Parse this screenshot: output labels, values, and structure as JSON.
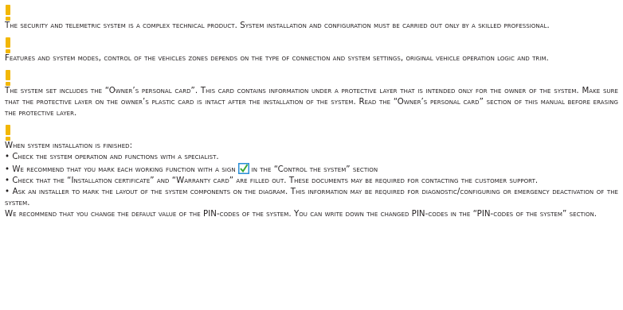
{
  "notices": {
    "n1": {
      "text": "The security and telemetric system is a complex technical product. System installation and configuration must be carried out only by a skilled professional."
    },
    "n2": {
      "text": "Features and system modes, control of the vehicles zones depends on the type of connection and system settings, original vehicle operation logic and trim."
    },
    "n3": {
      "text": "The system set includes the “Owner’s personal card”. This card contains information under a protective layer that is intended only for the owner of the system. Make sure that the protective layer on the owner’s plastic card is intact after the installation of the system. Read the “Owner’s personal card” section of this manual before erasing the protective layer."
    },
    "n4": {
      "heading": "When system installation is finished:",
      "items": [
        "• Check the system operation and functions with a specialist.",
        "• We recommend that you mark each working function with a sign",
        "in the “Control the system” section",
        "• Check that the “Installation certificate” and “Warranty card” are filled out. These documents may be required for contacting the customer support.",
        "• Ask an installer to mark the layout of the system components on the diagram. This information may be required for diagnostic/configuring or emergency deactivation of the system."
      ],
      "closing": "We recommend that you change the default value of the PIN-codes of the system. You can write down the changed PIN-codes in the “PIN-codes of the system” section."
    }
  },
  "icons": {
    "exclamation": "exclamation-mark-icon",
    "checkbox": "checkbox-checked-icon"
  },
  "colors": {
    "accent_yellow": "#f2b705",
    "checkbox_blue": "#2a8fd6",
    "checkbox_green": "#3aa935"
  }
}
